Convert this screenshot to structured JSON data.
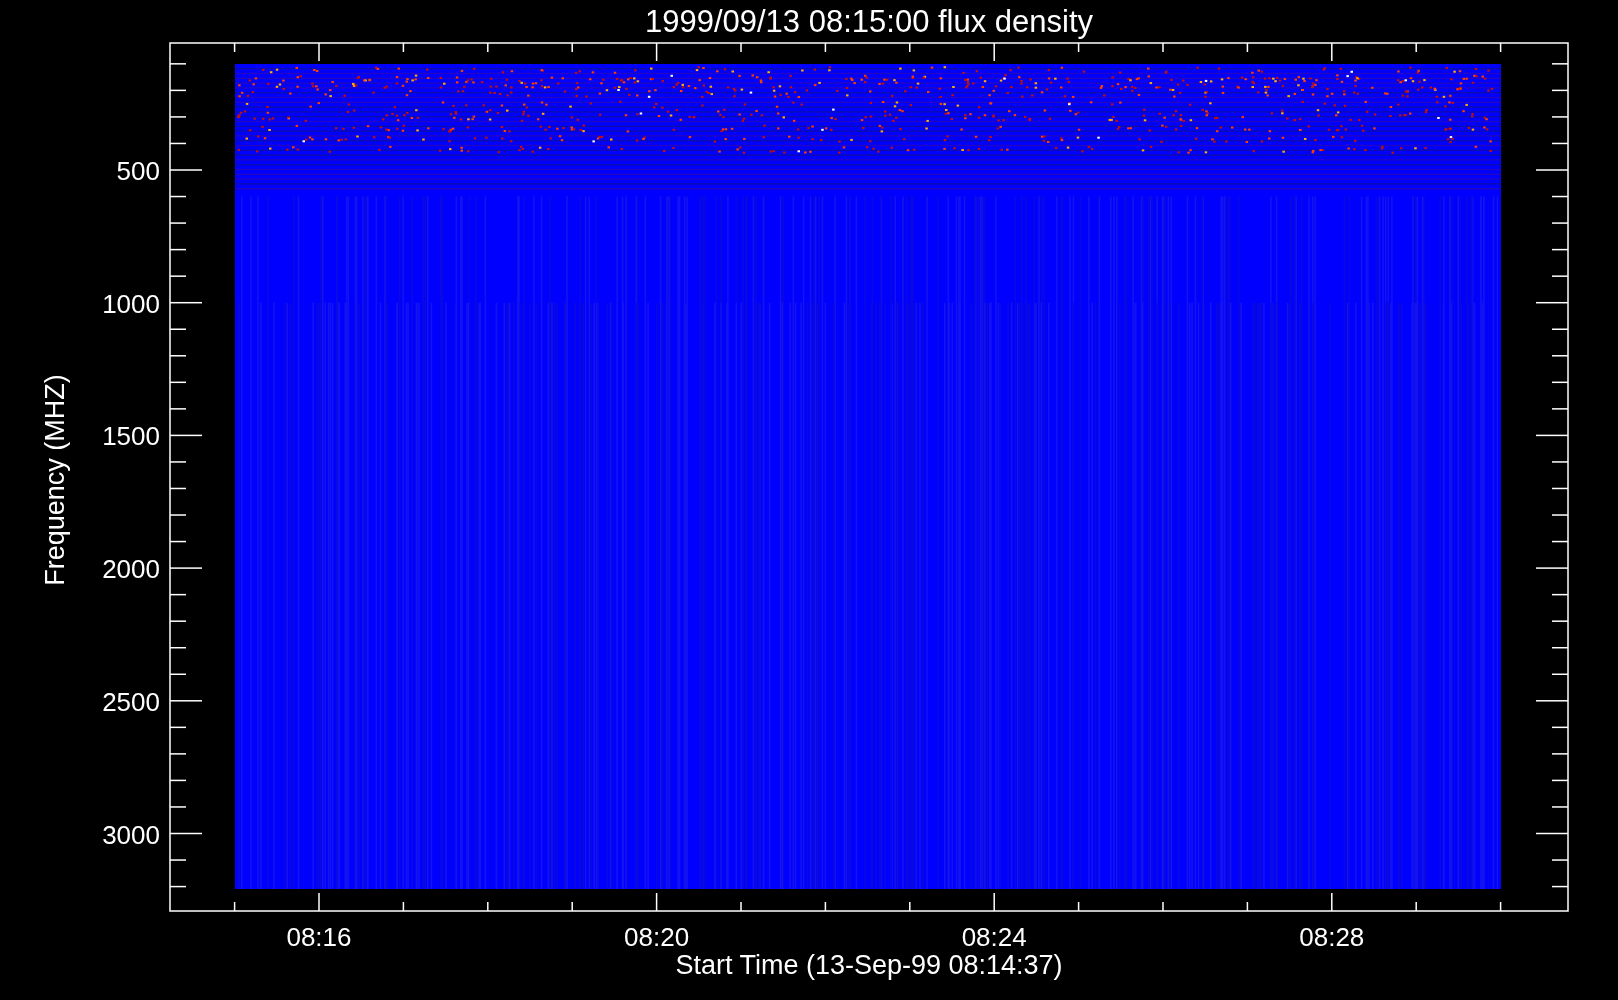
{
  "title": "1999/09/13 08:15:00 flux density",
  "x_axis": {
    "label": "Start Time (13-Sep-99 08:14:37)",
    "tick_labels": [
      "08:16",
      "08:20",
      "08:24",
      "08:28"
    ]
  },
  "y_axis": {
    "label": "Frequency (MHZ)",
    "tick_labels": [
      "500",
      "1000",
      "1500",
      "2000",
      "2500",
      "3000"
    ]
  }
}
